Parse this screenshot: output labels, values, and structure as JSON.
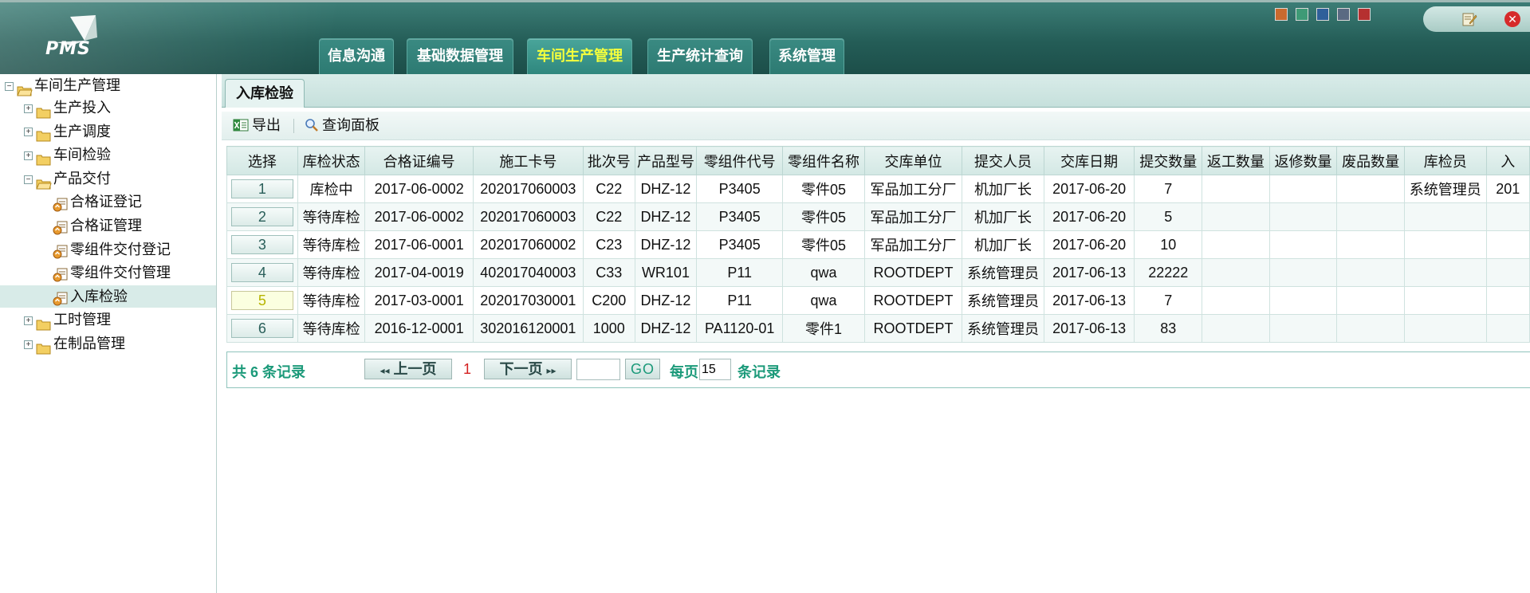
{
  "app": {
    "logo_text": "PMS"
  },
  "top_menu": [
    {
      "label": "信息沟通",
      "active": false
    },
    {
      "label": "基础数据管理",
      "active": false
    },
    {
      "label": "车间生产管理",
      "active": true
    },
    {
      "label": "生产统计查询",
      "active": false
    },
    {
      "label": "系统管理",
      "active": false
    }
  ],
  "theme_colors": [
    "#c86a2e",
    "#3e9a76",
    "#2f5f9a",
    "#5a6a82",
    "#b53030"
  ],
  "sidebar": {
    "root": "车间生产管理",
    "items": [
      {
        "label": "生产投入",
        "type": "folder",
        "expander": "+"
      },
      {
        "label": "生产调度",
        "type": "folder",
        "expander": "+"
      },
      {
        "label": "车间检验",
        "type": "folder",
        "expander": "+"
      },
      {
        "label": "产品交付",
        "type": "folder",
        "expander": "−"
      },
      {
        "label": "合格证登记",
        "type": "page"
      },
      {
        "label": "合格证管理",
        "type": "page"
      },
      {
        "label": "零组件交付登记",
        "type": "page"
      },
      {
        "label": "零组件交付管理",
        "type": "page"
      },
      {
        "label": "入库检验",
        "type": "page",
        "selected": true
      },
      {
        "label": "工时管理",
        "type": "folder",
        "expander": "+"
      },
      {
        "label": "在制品管理",
        "type": "folder",
        "expander": "+"
      }
    ]
  },
  "page_tab": "入库检验",
  "toolbar": {
    "export_label": "导出",
    "query_label": "查询面板"
  },
  "table": {
    "columns": [
      "选择",
      "库检状态",
      "合格证编号",
      "施工卡号",
      "批次号",
      "产品型号",
      "零组件代号",
      "零组件名称",
      "交库单位",
      "提交人员",
      "交库日期",
      "提交数量",
      "返工数量",
      "返修数量",
      "废品数量",
      "库检员",
      "入"
    ],
    "rows": [
      [
        "1",
        "库检中",
        "2017-06-0002",
        "202017060003",
        "C22",
        "DHZ-12",
        "P3405",
        "零件05",
        "军品加工分厂",
        "机加厂长",
        "2017-06-20",
        "7",
        "",
        "",
        "",
        "系统管理员",
        "201"
      ],
      [
        "2",
        "等待库检",
        "2017-06-0002",
        "202017060003",
        "C22",
        "DHZ-12",
        "P3405",
        "零件05",
        "军品加工分厂",
        "机加厂长",
        "2017-06-20",
        "5",
        "",
        "",
        "",
        "",
        ""
      ],
      [
        "3",
        "等待库检",
        "2017-06-0001",
        "202017060002",
        "C23",
        "DHZ-12",
        "P3405",
        "零件05",
        "军品加工分厂",
        "机加厂长",
        "2017-06-20",
        "10",
        "",
        "",
        "",
        "",
        ""
      ],
      [
        "4",
        "等待库检",
        "2017-04-0019",
        "402017040003",
        "C33",
        "WR101",
        "P11",
        "qwa",
        "ROOTDEPT",
        "系统管理员",
        "2017-06-13",
        "22222",
        "",
        "",
        "",
        "",
        ""
      ],
      [
        "5",
        "等待库检",
        "2017-03-0001",
        "202017030001",
        "C200",
        "DHZ-12",
        "P11",
        "qwa",
        "ROOTDEPT",
        "系统管理员",
        "2017-06-13",
        "7",
        "",
        "",
        "",
        "",
        ""
      ],
      [
        "6",
        "等待库检",
        "2016-12-0001",
        "302016120001",
        "1000",
        "DHZ-12",
        "PA1120-01",
        "零件1",
        "ROOTDEPT",
        "系统管理员",
        "2017-06-13",
        "83",
        "",
        "",
        "",
        "",
        ""
      ]
    ],
    "highlighted_row": 5
  },
  "pager": {
    "total_text": "共 6 条记录",
    "prev_label": "上一页",
    "current_page": "1",
    "next_label": "下一页",
    "goto_value": "",
    "go_label": "GO",
    "per_page_label": "每页",
    "per_page_value": "15",
    "records_label": "条记录"
  }
}
